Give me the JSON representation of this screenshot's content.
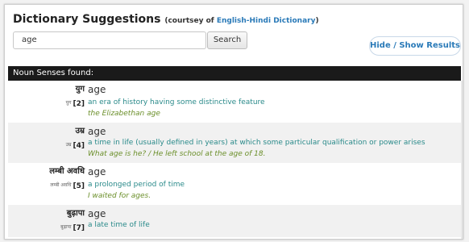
{
  "header": {
    "title": "Dictionary Suggestions",
    "courtesy_prefix": "(courtsey of",
    "courtesy_link": "English-Hindi Dictionary",
    "courtesy_suffix": ")"
  },
  "search": {
    "value": "age",
    "button_label": "Search"
  },
  "toggle_button_label": "Hide / Show Results",
  "section_title": "Noun Senses found:",
  "senses": [
    {
      "hindi": "युग",
      "transliteration": "युग",
      "number": "[2]",
      "word": "age",
      "definition": "an era of history having some distinctive feature",
      "example": "the Elizabethan age"
    },
    {
      "hindi": "उम्र",
      "transliteration": "उम्र",
      "number": "[4]",
      "word": "age",
      "definition": "a time in life (usually defined in years) at which some particular qualification or power arises",
      "example": "What age is he? / He left school at the age of 18."
    },
    {
      "hindi": "लम्बी अवधि",
      "transliteration": "लम्बी अवधि",
      "number": "[5]",
      "word": "age",
      "definition": "a prolonged period of time",
      "example": "I waited for ages."
    },
    {
      "hindi": "बुढ़ापा",
      "transliteration": "बुढ़ापा",
      "number": "[7]",
      "word": "age",
      "definition": "a late time of life",
      "example": ""
    }
  ],
  "colors": {
    "link": "#2a7ab8",
    "definition": "#2a8a8a",
    "example": "#6b8f2a",
    "header_bar": "#1a1a1a"
  }
}
